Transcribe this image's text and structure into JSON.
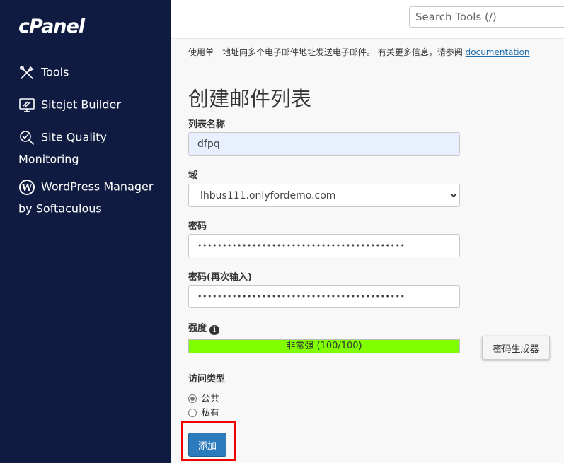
{
  "sidebar": {
    "logo": "cPanel",
    "items": [
      {
        "label": "Tools",
        "icon": "tools-icon"
      },
      {
        "label": "Sitejet Builder",
        "icon": "monitor-icon"
      },
      {
        "label": "Site Quality Monitoring",
        "icon": "magnifier-check-icon"
      },
      {
        "label": "WordPress Manager by Softaculous",
        "icon": "wordpress-icon"
      }
    ]
  },
  "header": {
    "search_placeholder": "Search Tools (/)"
  },
  "main": {
    "description": "使用单一地址向多个电子邮件地址发送电子邮件。 有关更多信息，请参阅 ",
    "description_link": "documentation",
    "title": "创建邮件列表",
    "list_name": {
      "label": "列表名称",
      "value": "dfpq"
    },
    "domain": {
      "label": "域",
      "value": "lhbus111.onlyfordemo.com"
    },
    "password": {
      "label": "密码",
      "value": "••••••••••••••••••••••••••••••••••••••••••"
    },
    "password_again": {
      "label": "密码(再次输入)",
      "value": "••••••••••••••••••••••••••••••••••••••••••"
    },
    "strength": {
      "label": "强度",
      "text": "非常强 (100/100)",
      "percent": 100,
      "color": "#7fff00"
    },
    "generator_button": "密码生成器",
    "access_type": {
      "label": "访问类型",
      "options": [
        {
          "label": "公共",
          "checked": true
        },
        {
          "label": "私有",
          "checked": false
        }
      ]
    },
    "add_button": "添加"
  },
  "colors": {
    "sidebar_bg": "#0f1b40",
    "primary_button": "#2c7bbd",
    "highlight": "#e00000",
    "link": "#1f6fad"
  }
}
